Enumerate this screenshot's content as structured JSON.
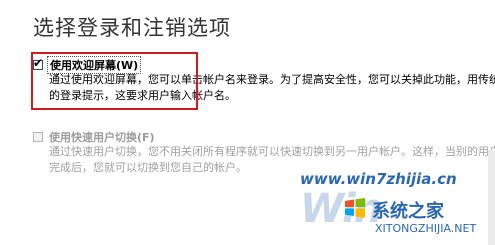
{
  "title": "选择登录和注销选项",
  "options": [
    {
      "label": "使用欢迎屏幕(W)",
      "checked": true,
      "enabled": true,
      "description": "通过使用欢迎屏幕，您可以单击帐户名来登录。为了提高安全性，您可以关掉此功能，用传统的登录提示，这要求用户输入帐户名。"
    },
    {
      "label": "使用快速用户切换(F)",
      "checked": false,
      "enabled": false,
      "description": "通过快速用户切换，您不用关闭所有程序就可以快速切换到另一用户帐户。这样，当别的用户完成后，您就可以切换到您自己的帐户。"
    }
  ],
  "watermark": {
    "url": "www.win7zhijia.cn",
    "big": "Win",
    "brand": "系统之家",
    "sub": "XITONGZHIJIA.NET",
    "logo_icon": "windows-flag-icon"
  },
  "colors": {
    "highlight": "#d21a1a",
    "watermark_blue": "#2a67b3"
  }
}
